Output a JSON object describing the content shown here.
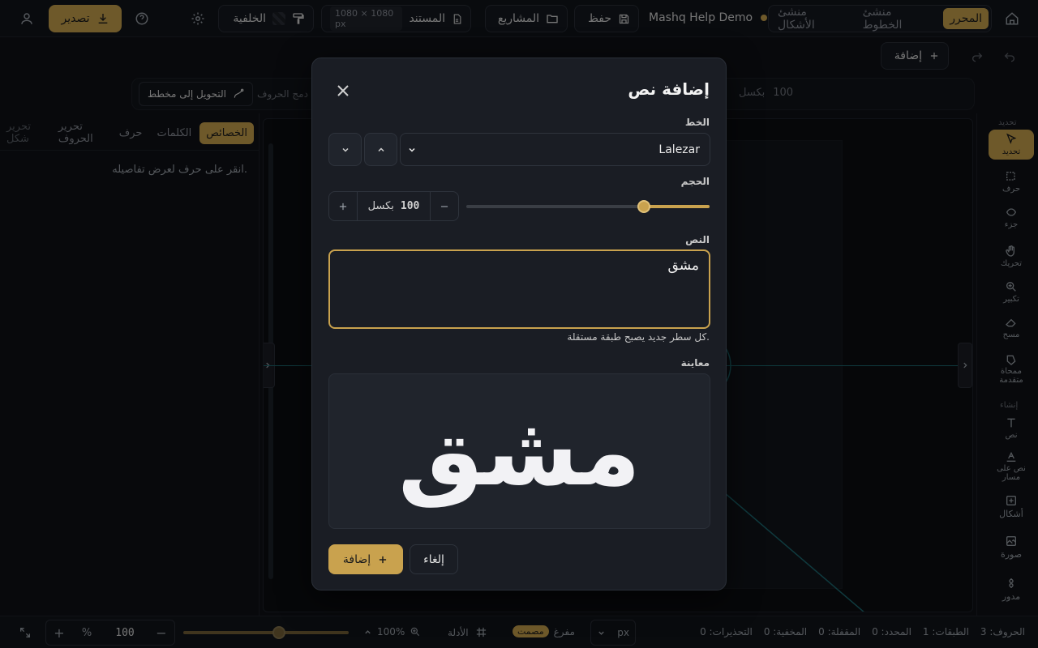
{
  "topbar": {
    "export_label": "تصدير",
    "background_label": "الخلفية",
    "document_label": "المستند",
    "document_size": "1080 × 1080 px",
    "projects_label": "المشاريع",
    "save_label": "حفظ",
    "project_name": "Mashq Help Demo",
    "tabs": [
      "المحرر",
      "منشئ الخطوط",
      "منشئ الأشكال"
    ]
  },
  "row2": {
    "add_label": "إضافة"
  },
  "toolrow": {
    "convert_label": "التحويل إلى مخطط",
    "merge_label": "دمج الحروف",
    "size_value": "100",
    "size_unit": "بكسل"
  },
  "leftpanel": {
    "tabs": [
      "الخصائص",
      "الكلمات",
      "حرف",
      "تحرير الحروف",
      "تحرير شكل"
    ],
    "empty_message": "انقر على حرف لعرض تفاصيله."
  },
  "rightbar": {
    "section_select": "تحديد",
    "section_create": "إنشاء",
    "tools": [
      {
        "label": "تحديد",
        "icon": "cursor-icon"
      },
      {
        "label": "حرف",
        "icon": "letter-select-icon"
      },
      {
        "label": "جزء",
        "icon": "part-icon"
      },
      {
        "label": "تحريك",
        "icon": "hand-icon"
      },
      {
        "label": "تكبير",
        "icon": "zoom-icon"
      },
      {
        "label": "مسح",
        "icon": "eraser-icon"
      },
      {
        "label": "ممحاة متقدمة",
        "icon": "advanced-eraser-icon"
      },
      {
        "label": "نص",
        "icon": "text-icon"
      },
      {
        "label": "نص على مسار",
        "icon": "text-path-icon"
      },
      {
        "label": "أشكال",
        "icon": "shapes-icon"
      },
      {
        "label": "صورة",
        "icon": "image-icon"
      },
      {
        "label": "مدور",
        "icon": "ornament-icon"
      }
    ]
  },
  "statusbar": {
    "letters": "الحروف: 3",
    "layers": "الطبقات: 1",
    "selected": "المحدد: 0",
    "locked": "المقفلة: 0",
    "hidden": "المخفية: 0",
    "warnings": "التحذيرات: 0",
    "unit": "px",
    "fill_mode": "مفرغ",
    "solid_mode": "مصمت",
    "guides": "الأدلة",
    "zoom_percent": "100%",
    "zoom_value": "100",
    "zoom_unit": "%"
  },
  "dialog": {
    "title": "إضافة نص",
    "font_label": "الخط",
    "font_value": "Lalezar",
    "size_label": "الحجم",
    "size_value": "100",
    "size_unit": "بكسل",
    "size_slider_fraction": 0.27,
    "text_label": "النص",
    "text_value": "مشق",
    "hint": "كل سطر جديد يصبح طبقة مستقلة.",
    "preview_label": "معاينة",
    "preview_text": "مشق",
    "add_button": "إضافة",
    "cancel_button": "إلغاء"
  }
}
